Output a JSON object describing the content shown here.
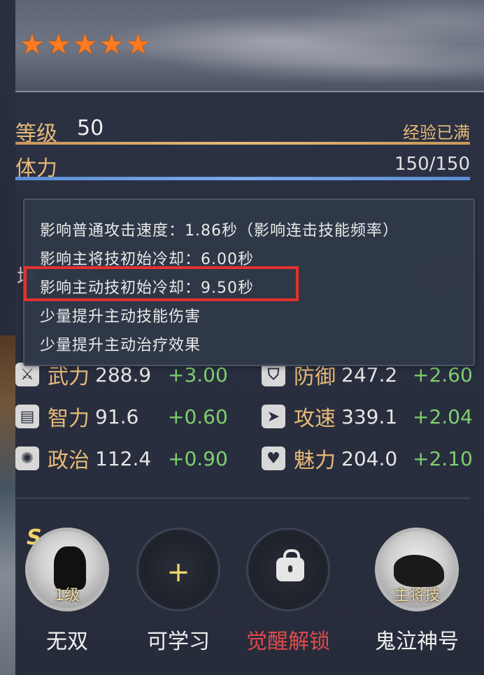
{
  "stars": [
    "★",
    "★",
    "★",
    "★",
    "★"
  ],
  "level": {
    "label": "等级",
    "value": "50",
    "status": "经验已满"
  },
  "stamina": {
    "label": "体力",
    "value": "150/150"
  },
  "tooltip": {
    "lines": [
      "影响普通攻击速度：1.86秒（影响连击技能频率）",
      "影响主将技初始冷却：6.00秒",
      "影响主动技初始冷却：9.50秒",
      "少量提升主动技能伤害",
      "少量提升主动治疗效果"
    ]
  },
  "obscured": {
    "left_char": "埗"
  },
  "stats": [
    {
      "name": "武力",
      "value": "288.9",
      "add": "+3.00",
      "icon": "sword-icon",
      "glyph": "⚔"
    },
    {
      "name": "防御",
      "value": "247.2",
      "add": "+2.60",
      "icon": "shield-icon",
      "glyph": "⛉"
    },
    {
      "name": "智力",
      "value": "91.6",
      "add": "+0.60",
      "icon": "scroll-icon",
      "glyph": "▤"
    },
    {
      "name": "攻速",
      "value": "339.1",
      "add": "+2.04",
      "icon": "boot-icon",
      "glyph": "➤"
    },
    {
      "name": "政治",
      "value": "112.4",
      "add": "+0.90",
      "icon": "gear-icon",
      "glyph": "✺"
    },
    {
      "name": "魅力",
      "value": "204.0",
      "add": "+2.10",
      "icon": "heart-icon",
      "glyph": "♥"
    }
  ],
  "skills": [
    {
      "name": "无双",
      "tag": "1级",
      "badge": "S"
    },
    {
      "name": "可学习",
      "symbol": "+"
    },
    {
      "name": "觉醒解锁"
    },
    {
      "name": "鬼泣神号",
      "tag": "主将技"
    }
  ],
  "colors": {
    "accent_gold": "#e7b978",
    "plus_green": "#7fcf6e",
    "highlight_red": "#e5302f",
    "awaken_red": "#e14a4a"
  }
}
